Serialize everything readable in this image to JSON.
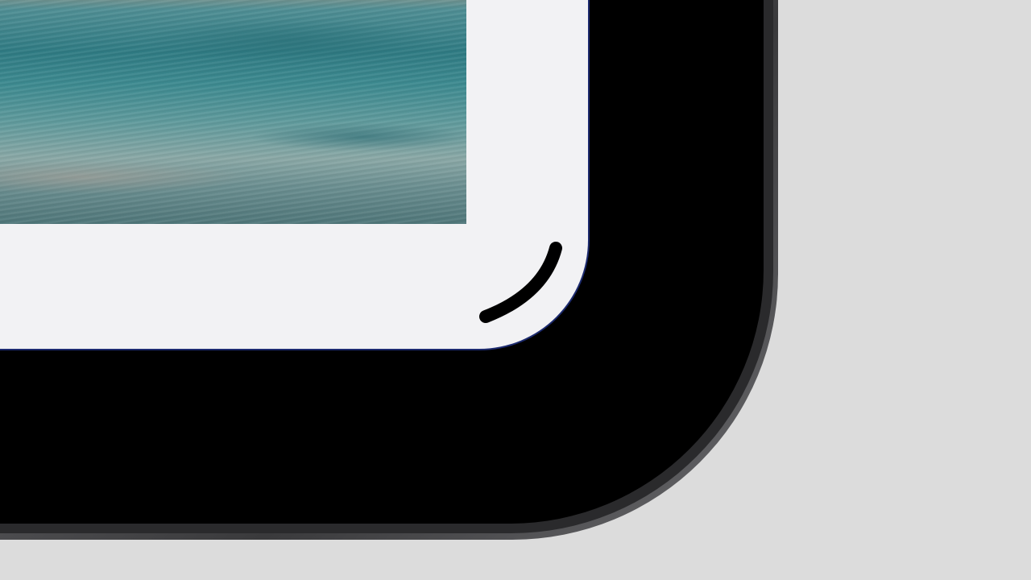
{
  "window": {
    "title": ""
  },
  "device": {
    "frame_color": "#5c5c5f",
    "bezel_color": "#000000",
    "screen_color": "#f2f2f4",
    "edge_glow_color": "#1c2a6e"
  },
  "screen": {
    "photo": {
      "subject": "sea-waves-photo"
    },
    "corner_indicator": {
      "icon": "corner-arc-icon",
      "color": "#000000"
    }
  },
  "background": {
    "color": "#dcdcdc"
  }
}
